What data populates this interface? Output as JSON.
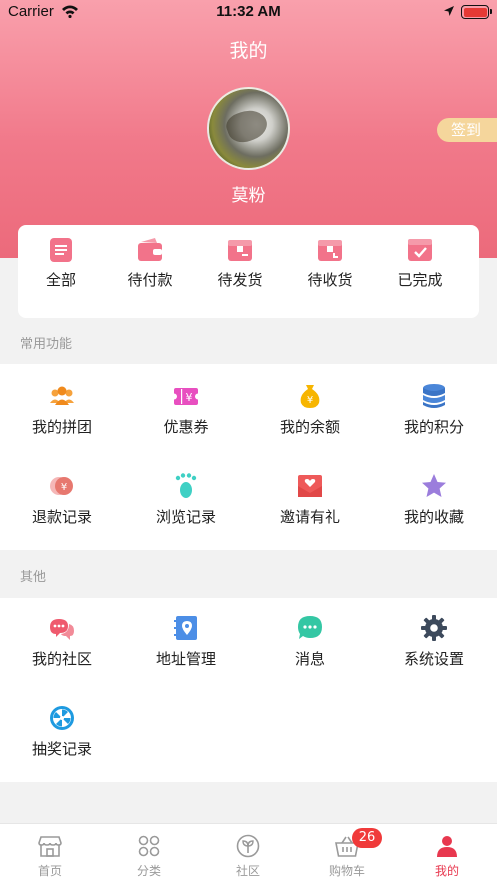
{
  "status_bar": {
    "carrier": "Carrier",
    "time": "11:32 AM"
  },
  "header": {
    "title": "我的",
    "user_name": "莫粉",
    "signin_label": "签到"
  },
  "orders": [
    {
      "label": "全部",
      "icon": "list-icon"
    },
    {
      "label": "待付款",
      "icon": "wallet-icon"
    },
    {
      "label": "待发货",
      "icon": "shipping-box-icon"
    },
    {
      "label": "待收货",
      "icon": "receive-box-icon"
    },
    {
      "label": "已完成",
      "icon": "check-box-icon"
    }
  ],
  "common": {
    "title": "常用功能",
    "items": [
      {
        "label": "我的拼团",
        "icon": "group-icon"
      },
      {
        "label": "优惠券",
        "icon": "coupon-icon"
      },
      {
        "label": "我的余额",
        "icon": "money-bag-icon"
      },
      {
        "label": "我的积分",
        "icon": "coins-stack-icon"
      },
      {
        "label": "退款记录",
        "icon": "refund-icon"
      },
      {
        "label": "浏览记录",
        "icon": "footprint-icon"
      },
      {
        "label": "邀请有礼",
        "icon": "invite-envelope-icon"
      },
      {
        "label": "我的收藏",
        "icon": "star-icon"
      }
    ]
  },
  "other": {
    "title": "其他",
    "items": [
      {
        "label": "我的社区",
        "icon": "chat-bubbles-icon"
      },
      {
        "label": "地址管理",
        "icon": "address-book-icon"
      },
      {
        "label": "消息",
        "icon": "message-icon"
      },
      {
        "label": "系统设置",
        "icon": "gear-icon"
      },
      {
        "label": "抽奖记录",
        "icon": "lottery-wheel-icon"
      }
    ]
  },
  "tabbar": {
    "items": [
      {
        "label": "首页",
        "icon": "store-icon"
      },
      {
        "label": "分类",
        "icon": "category-grid-icon"
      },
      {
        "label": "社区",
        "icon": "community-sprout-icon"
      },
      {
        "label": "购物车",
        "icon": "basket-icon",
        "badge": "26"
      },
      {
        "label": "我的",
        "icon": "person-icon",
        "active": true
      }
    ]
  },
  "colors": {
    "header_top": "#f9a0ac",
    "header_bottom": "#ec6a7b",
    "accent": "#e8384f",
    "badge": "#f03a3a",
    "signin_bg": "#f5d69c"
  }
}
